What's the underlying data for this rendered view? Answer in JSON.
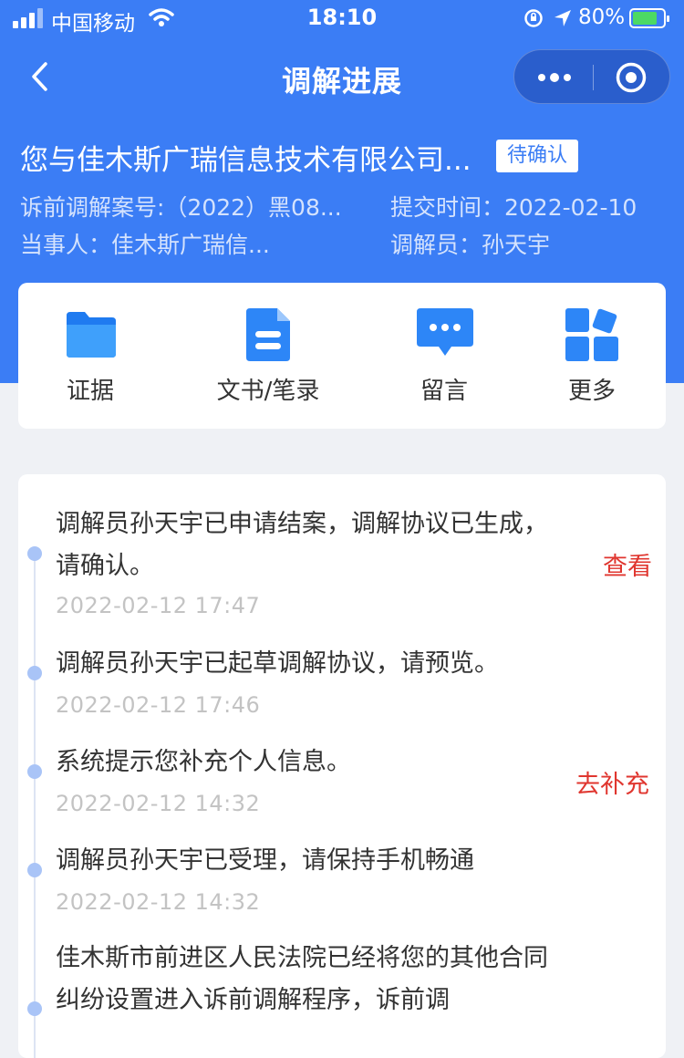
{
  "status_bar": {
    "carrier": "中国移动",
    "time": "18:10",
    "battery": "80%",
    "battery_level": 0.8
  },
  "nav": {
    "title": "调解进展",
    "icons": [
      "back-arrow-icon",
      "more-dots-icon",
      "close-circle-icon"
    ]
  },
  "case": {
    "title": "您与佳木斯广瑞信息技术有限公司...",
    "badge": "待确认",
    "case_no": "诉前调解案号:（2022）黑08...",
    "submit_time": "提交时间：2022-02-10",
    "party": "当事人：佳木斯广瑞信...",
    "mediator": "调解员：孙天宇"
  },
  "quick_actions": [
    {
      "label": "证据",
      "icon": "folder-icon"
    },
    {
      "label": "文书/笔录",
      "icon": "document-icon"
    },
    {
      "label": "留言",
      "icon": "message-icon"
    },
    {
      "label": "更多",
      "icon": "grid-icon"
    }
  ],
  "timeline": [
    {
      "text": "调解员孙天宇已申请结案，调解协议已生成，请确认。",
      "time": "2022-02-12 17:47",
      "action": "查看"
    },
    {
      "text": "调解员孙天宇已起草调解协议，请预览。",
      "time": "2022-02-12 17:46",
      "action": ""
    },
    {
      "text": "系统提示您补充个人信息。",
      "time": "2022-02-12 14:32",
      "action": "去补充"
    },
    {
      "text": "调解员孙天宇已受理，请保持手机畅通",
      "time": "2022-02-12 14:32",
      "action": ""
    },
    {
      "text": "佳木斯市前进区人民法院已经将您的其他合同纠纷设置进入诉前调解程序，诉前调",
      "time": "",
      "action": ""
    }
  ],
  "colors": {
    "primary": "#3b7df5",
    "page_bg": "#eff1f5",
    "action_red": "#e0362f",
    "timestamp_gray": "#c3c3c3",
    "timeline_dot": "#a9c4f7"
  }
}
